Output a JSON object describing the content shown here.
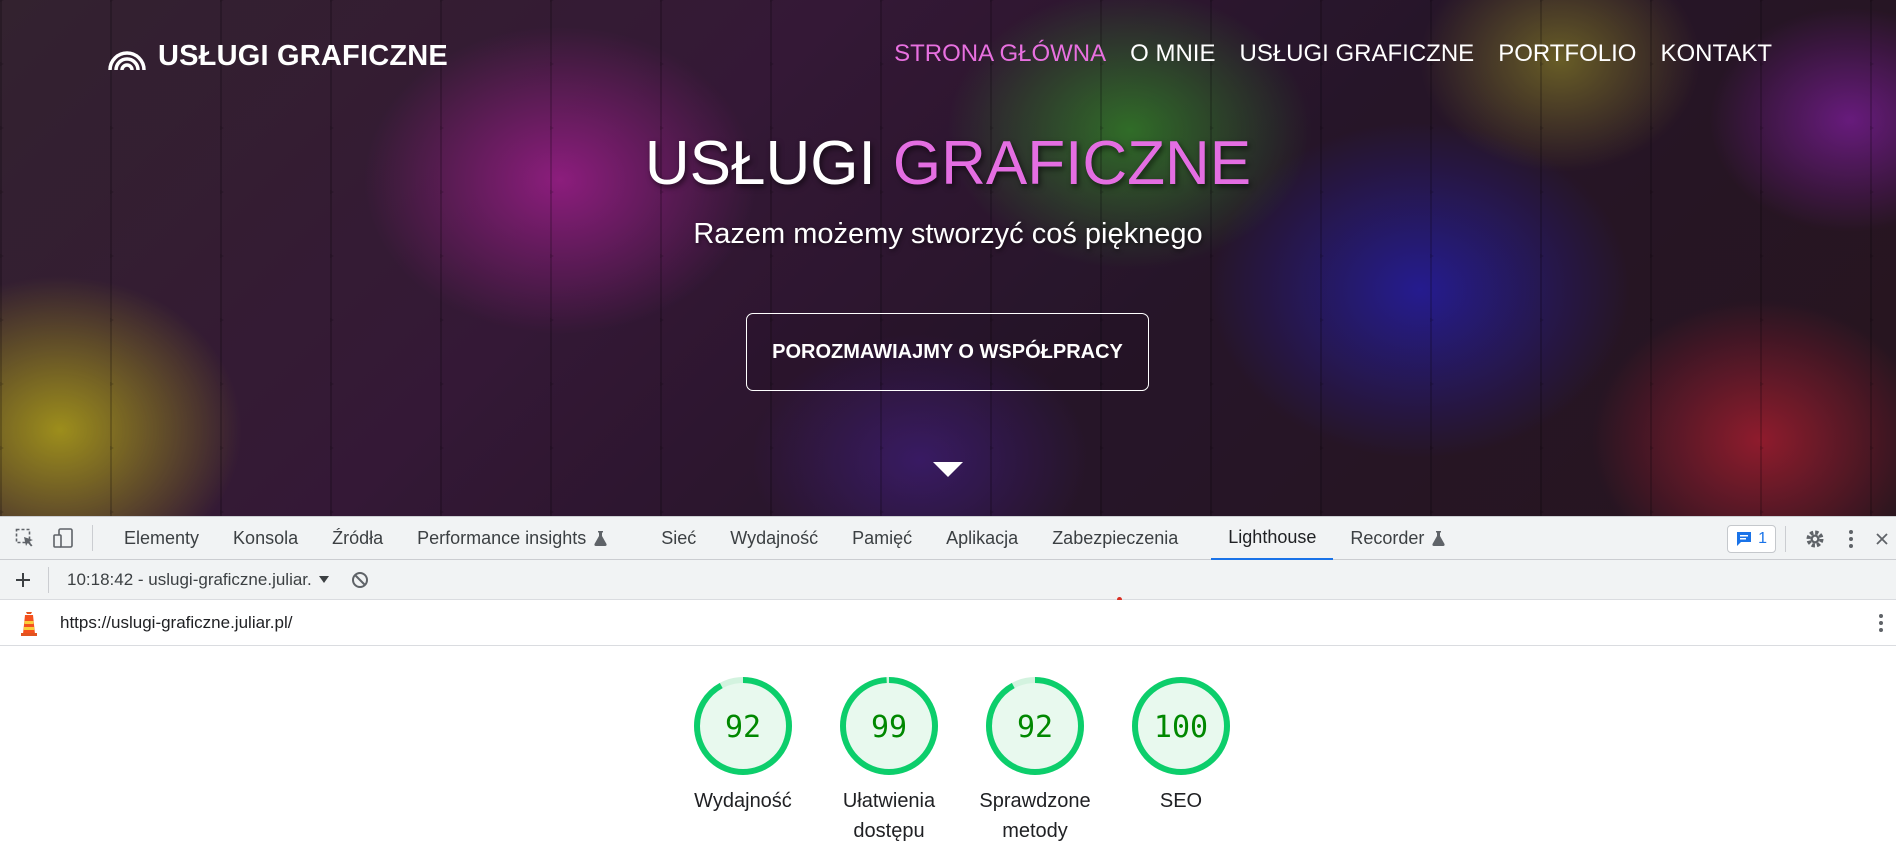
{
  "site": {
    "logo_text": "USŁUGI GRAFICZNE",
    "nav": [
      {
        "label": "STRONA GŁÓWNA",
        "active": true
      },
      {
        "label": "O MNIE",
        "active": false
      },
      {
        "label": "USŁUGI GRAFICZNE",
        "active": false
      },
      {
        "label": "PORTFOLIO",
        "active": false
      },
      {
        "label": "KONTAKT",
        "active": false
      }
    ],
    "hero": {
      "title_main": "USŁUGI",
      "title_accent": "GRAFICZNE",
      "subtitle": "Razem możemy stworzyć coś pięknego",
      "cta_label": "POROZMAWIAJMY O WSPÓŁPRACY"
    },
    "colors": {
      "accent": "#e46ee2"
    }
  },
  "devtools": {
    "tabs": [
      {
        "label": "Elementy"
      },
      {
        "label": "Konsola"
      },
      {
        "label": "Źródła"
      },
      {
        "label": "Performance insights",
        "experimental": true
      },
      {
        "label": "Sieć"
      },
      {
        "label": "Wydajność"
      },
      {
        "label": "Pamięć"
      },
      {
        "label": "Aplikacja"
      },
      {
        "label": "Zabezpieczenia"
      },
      {
        "label": "Lighthouse",
        "active": true
      },
      {
        "label": "Recorder",
        "experimental": true
      }
    ],
    "issues_count": "1",
    "report_selector": "10:18:42 - uslugi-graficzne.juliar.pl",
    "url": "https://uslugi-graficzne.juliar.pl/",
    "colors": {
      "active_tab_underline": "#1a73e8",
      "score_good": "#0cce6b",
      "score_text": "#008800"
    }
  },
  "lighthouse": {
    "scores": [
      {
        "value": 92,
        "label": "Wydajność"
      },
      {
        "value": 99,
        "label": "Ułatwienia dostępu"
      },
      {
        "value": 92,
        "label": "Sprawdzone metody"
      },
      {
        "value": 100,
        "label": "SEO"
      }
    ]
  }
}
